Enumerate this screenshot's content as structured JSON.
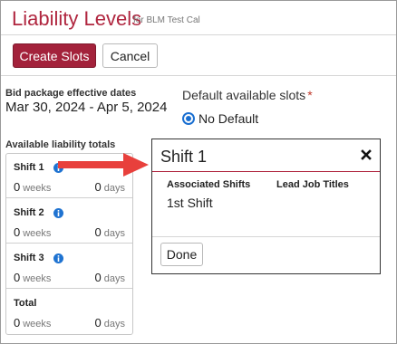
{
  "header": {
    "title": "Liability Levels",
    "subtitle": "for BLM Test Cal"
  },
  "toolbar": {
    "create_label": "Create Slots",
    "cancel_label": "Cancel"
  },
  "bid_package": {
    "label": "Bid package effective dates",
    "dates": "Mar 30, 2024 - Apr 5, 2024"
  },
  "default_slots": {
    "label": "Default available slots",
    "required_mark": "*",
    "option": "No Default",
    "selected": true
  },
  "availability": {
    "label": "Available liability totals",
    "weeks_unit": "weeks",
    "days_unit": "days",
    "slots": [
      {
        "name": "Shift 1",
        "weeks": "0",
        "days": "0",
        "info_icon": "info-icon"
      },
      {
        "name": "Shift 2",
        "weeks": "0",
        "days": "0",
        "info_icon": "info-icon"
      },
      {
        "name": "Shift 3",
        "weeks": "0",
        "days": "0",
        "info_icon": "info-icon"
      },
      {
        "name": "Total",
        "weeks": "0",
        "days": "0"
      }
    ]
  },
  "popover": {
    "title": "Shift 1",
    "col_associated": "Associated Shifts",
    "col_lead": "Lead Job Titles",
    "associated_value": "1st Shift",
    "done_label": "Done",
    "close_icon": "close-icon"
  },
  "colors": {
    "brand": "#b0263f",
    "primary_button": "#a3223b",
    "info": "#1f73d1",
    "arrow": "#e8403c"
  }
}
